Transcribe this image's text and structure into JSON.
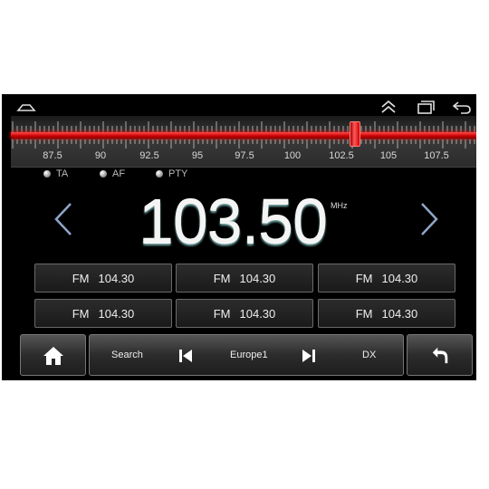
{
  "nav": {
    "home_icon": "home-outline-icon",
    "up_icon": "double-chevron-up-icon",
    "recents_icon": "recents-icon",
    "back_icon": "back-arrow-icon"
  },
  "tuner": {
    "scale_labels": [
      "87.5",
      "90",
      "92.5",
      "95",
      "97.5",
      "100",
      "102.5",
      "105",
      "107.5"
    ],
    "indicator_color": "#e01010"
  },
  "indicators": [
    {
      "label": "TA"
    },
    {
      "label": "AF"
    },
    {
      "label": "PTY"
    }
  ],
  "display": {
    "frequency": "103.50",
    "unit": "MHz"
  },
  "presets": [
    {
      "band": "FM",
      "freq": "104.30"
    },
    {
      "band": "FM",
      "freq": "104.30"
    },
    {
      "band": "FM",
      "freq": "104.30"
    },
    {
      "band": "FM",
      "freq": "104.30"
    },
    {
      "band": "FM",
      "freq": "104.30"
    },
    {
      "band": "FM",
      "freq": "104.30"
    }
  ],
  "controls": {
    "search": "Search",
    "station": "Europe1",
    "dx": "DX"
  }
}
